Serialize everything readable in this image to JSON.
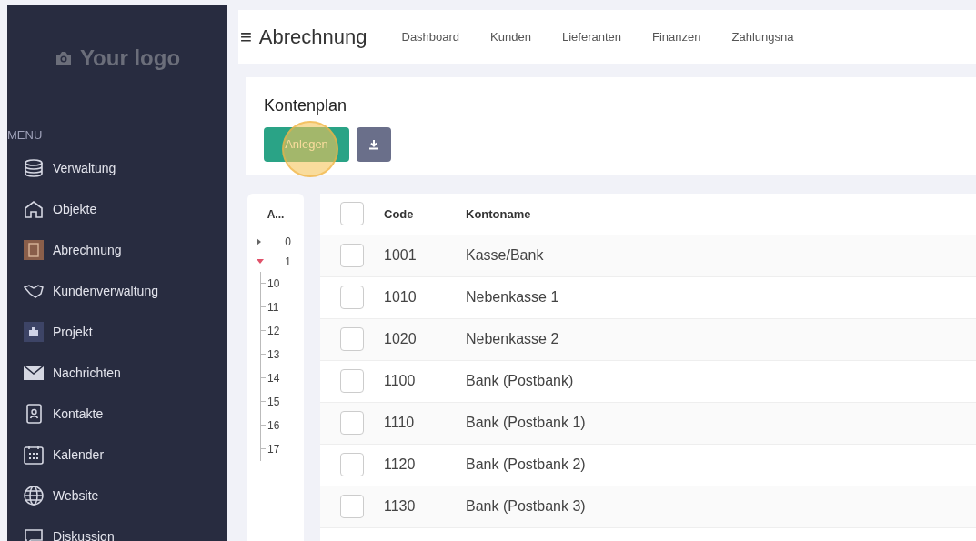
{
  "sidebar": {
    "logo": "Your logo",
    "section": "MENU",
    "items": [
      {
        "label": "Verwaltung"
      },
      {
        "label": "Objekte"
      },
      {
        "label": "Abrechnung"
      },
      {
        "label": "Kundenverwaltung"
      },
      {
        "label": "Projekt"
      },
      {
        "label": "Nachrichten"
      },
      {
        "label": "Kontakte"
      },
      {
        "label": "Kalender"
      },
      {
        "label": "Website"
      },
      {
        "label": "Diskussion"
      }
    ]
  },
  "header": {
    "menu_icon": "≡",
    "title": "Abrechnung",
    "nav": [
      "Dashboard",
      "Kunden",
      "Lieferanten",
      "Finanzen",
      "Zahlungsna"
    ]
  },
  "card": {
    "title": "Kontenplan",
    "create_button": "Anlegen"
  },
  "tree": {
    "heading": "A...",
    "items": [
      {
        "label": "0",
        "expanded": false
      },
      {
        "label": "1",
        "expanded": true,
        "children": [
          {
            "label": "10"
          },
          {
            "label": "11"
          },
          {
            "label": "12"
          },
          {
            "label": "13"
          },
          {
            "label": "14"
          },
          {
            "label": "15"
          },
          {
            "label": "16"
          },
          {
            "label": "17"
          }
        ]
      }
    ]
  },
  "table": {
    "select_all_checked": false,
    "columns": [
      "Code",
      "Kontoname"
    ],
    "rows": [
      {
        "code": "1001",
        "name": "Kasse/Bank",
        "checked": false
      },
      {
        "code": "1010",
        "name": "Nebenkasse 1",
        "checked": false
      },
      {
        "code": "1020",
        "name": "Nebenkasse 2",
        "checked": false
      },
      {
        "code": "1100",
        "name": "Bank (Postbank)",
        "checked": false
      },
      {
        "code": "1110",
        "name": "Bank (Postbank 1)",
        "checked": false
      },
      {
        "code": "1120",
        "name": "Bank (Postbank 2)",
        "checked": false
      },
      {
        "code": "1130",
        "name": "Bank (Postbank 3)",
        "checked": false
      }
    ]
  }
}
